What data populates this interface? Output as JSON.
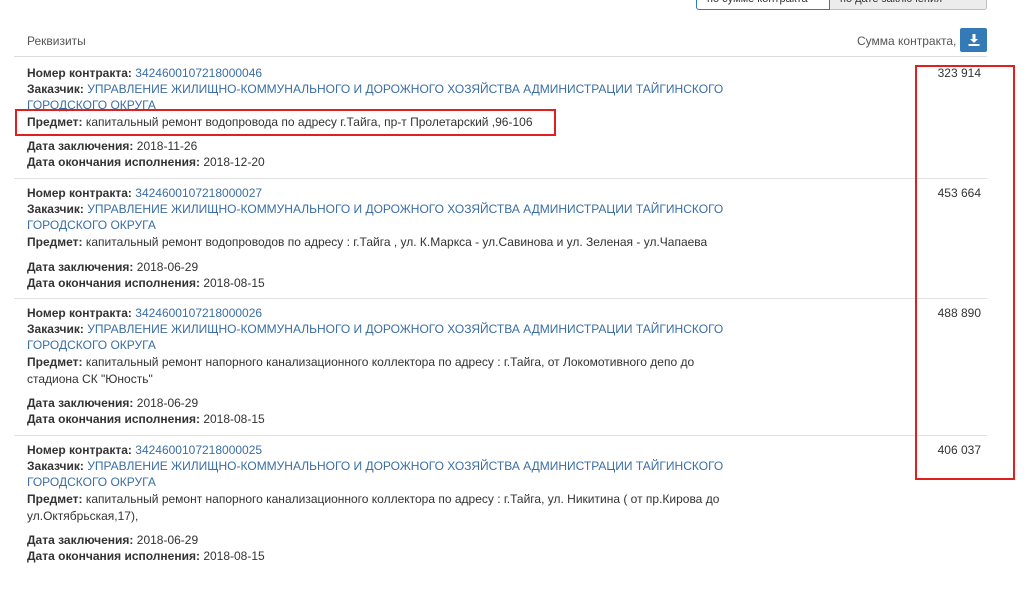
{
  "sort_buttons": [
    {
      "label": "по сумме контракта",
      "active": true
    },
    {
      "label": "по дате заключения",
      "active": false
    }
  ],
  "header": {
    "requisites": "Реквизиты",
    "amount": "Сумма контракта, р"
  },
  "labels": {
    "number": "Номер контракта:",
    "customer": "Заказчик:",
    "subject": "Предмет:",
    "signed": "Дата заключения:",
    "end": "Дата окончания исполнения:"
  },
  "contracts": [
    {
      "number": "3424600107218000046",
      "customer_1": "УПРАВЛЕНИЕ ЖИЛИЩНО-КОММУНАЛЬНОГО И ДОРОЖНОГО ХОЗЯЙСТВА АДМИНИСТРАЦИИ ТАЙГИНСКОГО",
      "customer_2": "ГОРОДСКОГО ОКРУГА",
      "subject_1": "капитальный ремонт водопровода по адресу г.Тайга, пр-т Пролетарский ,96-106",
      "subject_2": "",
      "signed": "2018-11-26",
      "end": "2018-12-20",
      "amount": "323 914"
    },
    {
      "number": "3424600107218000027",
      "customer_1": "УПРАВЛЕНИЕ ЖИЛИЩНО-КОММУНАЛЬНОГО И ДОРОЖНОГО ХОЗЯЙСТВА АДМИНИСТРАЦИИ ТАЙГИНСКОГО",
      "customer_2": "ГОРОДСКОГО ОКРУГА",
      "subject_1": "капитальный ремонт водопроводов по адресу : г.Тайга , ул. К.Маркса - ул.Савинова и ул. Зеленая - ул.Чапаева",
      "subject_2": "",
      "signed": "2018-06-29",
      "end": "2018-08-15",
      "amount": "453 664"
    },
    {
      "number": "3424600107218000026",
      "customer_1": "УПРАВЛЕНИЕ ЖИЛИЩНО-КОММУНАЛЬНОГО И ДОРОЖНОГО ХОЗЯЙСТВА АДМИНИСТРАЦИИ ТАЙГИНСКОГО",
      "customer_2": "ГОРОДСКОГО ОКРУГА",
      "subject_1": "капитальный ремонт напорного канализационного коллектора по адресу : г.Тайга, от Локомотивного депо до",
      "subject_2": "стадиона СК \"Юность\"",
      "signed": "2018-06-29",
      "end": "2018-08-15",
      "amount": "488 890"
    },
    {
      "number": "3424600107218000025",
      "customer_1": "УПРАВЛЕНИЕ ЖИЛИЩНО-КОММУНАЛЬНОГО И ДОРОЖНОГО ХОЗЯЙСТВА АДМИНИСТРАЦИИ ТАЙГИНСКОГО",
      "customer_2": "ГОРОДСКОГО ОКРУГА",
      "subject_1": "капитальный ремонт напорного канализационного коллектора по адресу : г.Тайга, ул. Никитина ( от пр.Кирова до",
      "subject_2": "ул.Октябрьская,17),",
      "signed": "2018-06-29",
      "end": "2018-08-15",
      "amount": "406 037"
    }
  ],
  "icons": {
    "download": "download-icon"
  },
  "colors": {
    "link": "#3a6ea5",
    "accent": "#337ab7",
    "highlight": "#e0201e"
  }
}
